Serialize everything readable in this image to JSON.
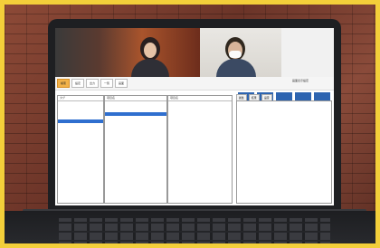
{
  "app": {
    "tabs": [
      {
        "label": "検索",
        "active": true
      },
      {
        "label": "設定",
        "active": false
      },
      {
        "label": "出力",
        "active": false
      },
      {
        "label": "一覧",
        "active": false
      },
      {
        "label": "画面",
        "active": false
      }
    ],
    "header_note": "画面表示設定",
    "left_list_header": "タグ",
    "middle_list_header": "項目名",
    "right_list_header": "項目名",
    "right_tabs": [
      "属性",
      "結果",
      "設定"
    ]
  }
}
